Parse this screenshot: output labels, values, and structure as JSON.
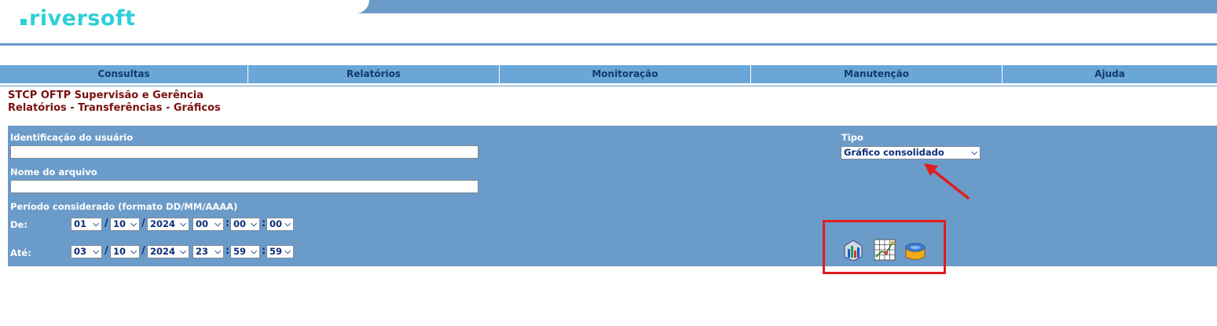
{
  "logo": {
    "text": "riversoft"
  },
  "menu": {
    "items": [
      {
        "label": "Consultas"
      },
      {
        "label": "Relatórios"
      },
      {
        "label": "Monitoração"
      },
      {
        "label": "Manutenção"
      },
      {
        "label": "Ajuda"
      }
    ]
  },
  "page": {
    "title": "STCP OFTP Supervisão e Gerência",
    "subtitle": "Relatórios - Transferências - Gráficos"
  },
  "form": {
    "user_id_label": "Identificação do usuário",
    "user_id_value": "",
    "filename_label": "Nome do arquivo",
    "filename_value": "",
    "period_label": "Período considerado (formato DD/MM/AAAA)",
    "from_label": "De:",
    "to_label": "Até:",
    "from": {
      "day": "01",
      "month": "10",
      "year": "2024",
      "hour": "00",
      "minute": "00",
      "second": "00"
    },
    "to": {
      "day": "03",
      "month": "10",
      "year": "2024",
      "hour": "23",
      "minute": "59",
      "second": "59"
    },
    "date_sep": "/",
    "time_sep": ":",
    "tipo_label": "Tipo",
    "tipo_value": "Gráfico consolidado"
  },
  "actions": {
    "icons": [
      "bar-chart-icon",
      "grid-chart-icon",
      "database-icon"
    ]
  },
  "colors": {
    "panel": "#6b9bc9",
    "menu": "#6aa7d8",
    "title": "#7a1010",
    "logo": "#2ecfd8",
    "highlight": "#e11d1d"
  }
}
